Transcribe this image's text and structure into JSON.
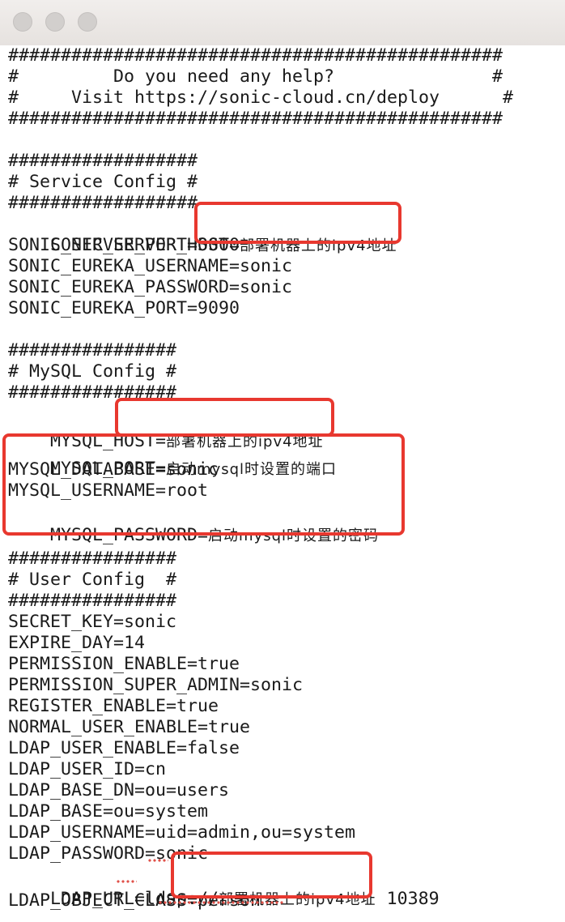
{
  "window": {
    "title": ""
  },
  "editor": {
    "lines": [
      "###############################################",
      "#         Do you need any help?               #",
      "#     Visit https://sonic-cloud.cn/deploy      #",
      "###############################################",
      "",
      "##################",
      "# Service Config #",
      "##################",
      "SONIC_SERVER_HOST=",
      "SONIC_SERVER_PORT=3000",
      "SONIC_EUREKA_USERNAME=sonic",
      "SONIC_EUREKA_PASSWORD=sonic",
      "SONIC_EUREKA_PORT=9090",
      "",
      "################",
      "# MySQL Config #",
      "################",
      "MYSQL_HOST=",
      "MYSQL_PORT=",
      "MYSQL_DATABASE=sonic",
      "MYSQL_USERNAME=root",
      "MYSQL_PASSWORD=",
      "",
      "################",
      "# User Config  #",
      "################",
      "SECRET_KEY=sonic",
      "EXPIRE_DAY=14",
      "PERMISSION_ENABLE=true",
      "PERMISSION_SUPER_ADMIN=sonic",
      "REGISTER_ENABLE=true",
      "NORMAL_USER_ENABLE=true",
      "LDAP_USER_ENABLE=false",
      "LDAP_USER_ID=cn",
      "LDAP_BASE_DN=ou=users",
      "LDAP_BASE=ou=system",
      "LDAP_USERNAME=uid=admin,ou=system",
      "LDAP_PASSWORD=sonic",
      "LDAP_URL=ldap://",
      "LDAP_OBJECT_CLASS=person"
    ],
    "annotations": {
      "deploy_ipv4": "部署机器上的ipv4地址",
      "mysql_port_note": "启动mysql时设置的端口",
      "mysql_password_note": "启动mysql时设置的密码",
      "ldap_port_suffix": " 10389"
    }
  },
  "colors": {
    "highlight_border": "#e8382f",
    "spellcheck_underline": "#e0524a",
    "text": "#1a1a1a"
  }
}
